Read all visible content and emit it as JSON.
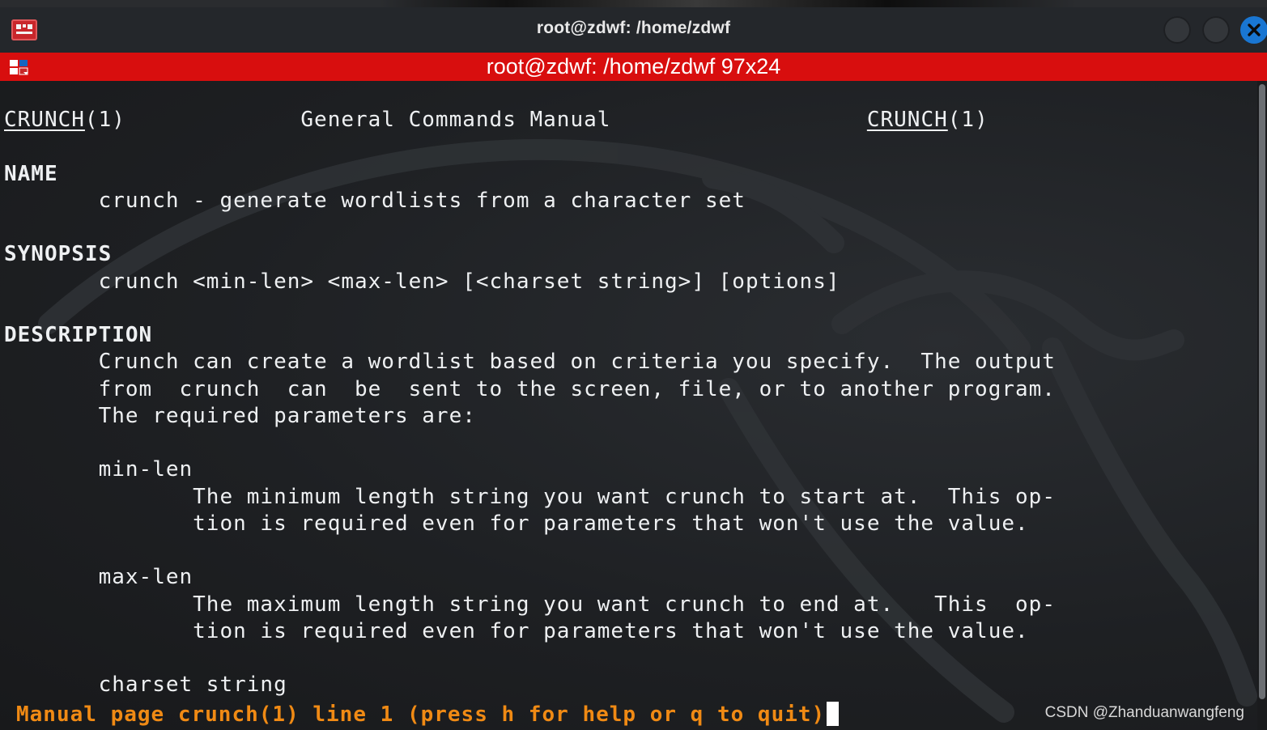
{
  "window": {
    "title": "root@zdwf: /home/zdwf",
    "tab_title": "root@zdwf: /home/zdwf 97x24"
  },
  "man_page": {
    "header_left_name": "CRUNCH",
    "header_left_section": "(1)",
    "header_center": "General Commands Manual",
    "header_right_name": "CRUNCH",
    "header_right_section": "(1)",
    "name_heading": "NAME",
    "name_text": "crunch - generate wordlists from a character set",
    "synopsis_heading": "SYNOPSIS",
    "synopsis_text": "crunch <min-len> <max-len> [<charset string>] [options]",
    "description_heading": "DESCRIPTION",
    "description_lines": [
      "Crunch can create a wordlist based on criteria you specify.  The output",
      "from  crunch  can  be  sent to the screen, file, or to another program.",
      "The required parameters are:"
    ],
    "min_len_term": "min-len",
    "min_len_lines": [
      "The minimum length string you want crunch to start at.  This op-",
      "tion is required even for parameters that won't use the value."
    ],
    "max_len_term": "max-len",
    "max_len_lines": [
      "The maximum length string you want crunch to end at.   This  op-",
      "tion is required even for parameters that won't use the value."
    ],
    "charset_term": "charset string"
  },
  "status_line": "Manual page crunch(1) line 1 (press h for help or q to quit)",
  "watermark": "CSDN @Zhanduanwangfeng",
  "colors": {
    "tab_bar": "#d80e0e",
    "status_text": "#f08a14",
    "close_button": "#1976d2",
    "terminal_bg": "#1e2023"
  },
  "icons": {
    "app": "terminal-app-icon",
    "tab": "split-pane-icon",
    "close": "close-icon"
  }
}
